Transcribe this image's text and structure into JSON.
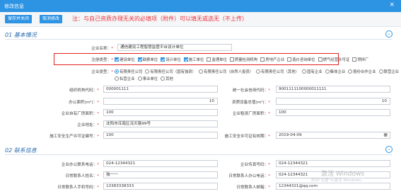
{
  "dialog": {
    "title": "修改信息",
    "close_icon": "close-icon"
  },
  "toolbar": {
    "save_label": "保存并关闭",
    "cancel_label": "取消修改",
    "notice": "注：与自己资质办理无关的必填项（附件）可以填无或选无（不上传）"
  },
  "sections": {
    "basic": "01 基本情况",
    "contact": "02 联系信息"
  },
  "basic": {
    "company_name_label": "企业名称：",
    "company_name_value": "通信建设工程智慧监管平台设计单位",
    "reg_type_label": "注册类型：",
    "reg_types": [
      {
        "label": "建设单位",
        "checked": true
      },
      {
        "label": "勘察单位",
        "checked": true
      },
      {
        "label": "设计单位",
        "checked": true
      },
      {
        "label": "施工单位",
        "checked": true
      },
      {
        "label": "监理单位",
        "checked": false
      },
      {
        "label": "质量检测机构",
        "checked": false
      },
      {
        "label": "房地产企业",
        "checked": false
      },
      {
        "label": "造价咨询单位",
        "checked": false
      },
      {
        "label": "燃气经营许可证",
        "checked": false
      },
      {
        "label": "预拌厂",
        "checked": false
      }
    ],
    "ent_type_label": "企业类型：",
    "ent_types_row1": [
      {
        "label": "有限责任公司",
        "selected": true
      },
      {
        "label": "有限责任公司（国有独资）",
        "selected": false
      },
      {
        "label": "有限责任公司（自然人投资）",
        "selected": false
      },
      {
        "label": "有限责任公司（其他）",
        "selected": false
      },
      {
        "label": "国有企业",
        "selected": false
      },
      {
        "label": "集体企业",
        "selected": false
      },
      {
        "label": "股份合作企业",
        "selected": false
      },
      {
        "label": "联营企业",
        "selected": false
      }
    ],
    "ent_types_row2": [
      {
        "label": "私营企业",
        "selected": false
      },
      {
        "label": "事业单位",
        "selected": false
      },
      {
        "label": "其他",
        "selected": false
      }
    ],
    "org_code_label": "组织机构代码：",
    "org_code_value": "000001111",
    "credit_code_label": "统一社会信用代码：",
    "credit_code_value": "9001111100000011111",
    "office_area_label": "办公面积(m²)：",
    "office_area_value": "10",
    "equipment_value_label": "资质设备总值(m²)：",
    "equipment_value_value": "10",
    "factory_area_label": "企业自有厂房面积：",
    "factory_area_value": "100",
    "leased_area_label": "企业租赁厂房面积：",
    "leased_area_value": "100",
    "address_label": "企业地址：",
    "address_value": "沈阳市浑南区浑天路99号",
    "safety_permit_label": "施工安全生产许可证编号：",
    "safety_permit_value": "100",
    "safety_date_label": "施工安全许可证有效期：",
    "safety_date_value": "2019-04-09",
    "calendar_icon": "calendar-icon"
  },
  "contact": {
    "office_phone_label": "企业办公联系电话：",
    "office_phone_value": "024-12344321",
    "fax_label": "企业传真号码：",
    "fax_value": "024-12344321",
    "daily_contact_label": "日常联系人姓名：",
    "daily_contact_value": "独一一",
    "daily_phone_label": "日常联系人办公电话：",
    "daily_phone_value": "024-12344321",
    "mobile_label": "日常联系人手机号码：",
    "mobile_value": "13383338333",
    "email_label": "日常联系人邮箱：",
    "email_value": "12344321@qq.com"
  },
  "watermark": {
    "line1": "激活 Windows",
    "line2": "转到\"设置\"以激活 Windows。"
  }
}
